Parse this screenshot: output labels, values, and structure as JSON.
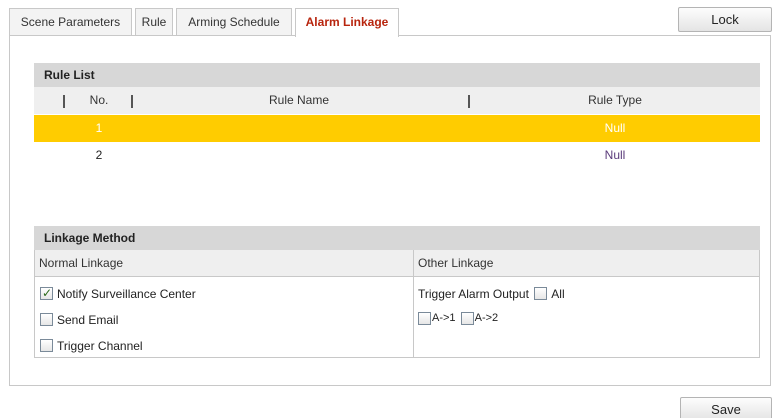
{
  "tabs": [
    {
      "label": "Scene Parameters",
      "active": false
    },
    {
      "label": "Rule",
      "active": false
    },
    {
      "label": "Arming Schedule",
      "active": false
    },
    {
      "label": "Alarm Linkage",
      "active": true
    }
  ],
  "lock_label": "Lock",
  "rule_list": {
    "title": "Rule List",
    "columns": [
      "No.",
      "Rule Name",
      "Rule Type"
    ],
    "rows": [
      {
        "no": "1",
        "name": "",
        "type": "Null",
        "selected": true
      },
      {
        "no": "2",
        "name": "",
        "type": "Null",
        "selected": false
      }
    ]
  },
  "linkage": {
    "title": "Linkage Method",
    "normal": {
      "heading": "Normal Linkage",
      "options": [
        {
          "label": "Notify Surveillance Center",
          "checked": true
        },
        {
          "label": "Send Email",
          "checked": false
        },
        {
          "label": "Trigger Channel",
          "checked": false
        }
      ]
    },
    "other": {
      "heading": "Other Linkage",
      "trigger_label": "Trigger Alarm Output",
      "all_label": "All",
      "outputs": [
        "A->1",
        "A->2"
      ]
    }
  },
  "save_label": "Save",
  "colors": {
    "selected_row": "#ffcc00",
    "active_tab_text": "#b8250e",
    "section_header": "#d7d7d7"
  }
}
